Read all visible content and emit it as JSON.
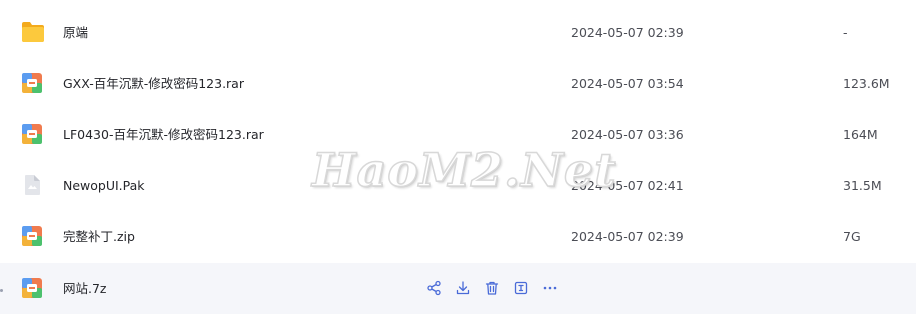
{
  "files": [
    {
      "name": "原端",
      "date": "2024-05-07 02:39",
      "size": "-",
      "icon": "folder-icon"
    },
    {
      "name": "GXX-百年沉默-修改密码123.rar",
      "date": "2024-05-07 03:54",
      "size": "123.6M",
      "icon": "archive-icon"
    },
    {
      "name": "LF0430-百年沉默-修改密码123.rar",
      "date": "2024-05-07 03:36",
      "size": "164M",
      "icon": "archive-icon"
    },
    {
      "name": "NewopUI.Pak",
      "date": "2024-05-07 02:41",
      "size": "31.5M",
      "icon": "generic-file-icon"
    },
    {
      "name": "完整补丁.zip",
      "date": "2024-05-07 02:39",
      "size": "7G",
      "icon": "archive-icon"
    },
    {
      "name": "网站.7z",
      "icon": "archive-icon",
      "hovered": true
    }
  ],
  "row_actions": [
    {
      "name": "share-icon"
    },
    {
      "name": "download-icon"
    },
    {
      "name": "delete-icon"
    },
    {
      "name": "rename-icon"
    },
    {
      "name": "more-icon"
    }
  ],
  "watermark": "HaoM2.Net",
  "colors": {
    "hover_row_background": "#f5f6fa",
    "folder_yellow": "#f9c23c",
    "archive_orange": "#f07b4e",
    "archive_green": "#4cc16d",
    "archive_blue": "#5b9cf0",
    "action_icon": "#4a6bd8"
  }
}
